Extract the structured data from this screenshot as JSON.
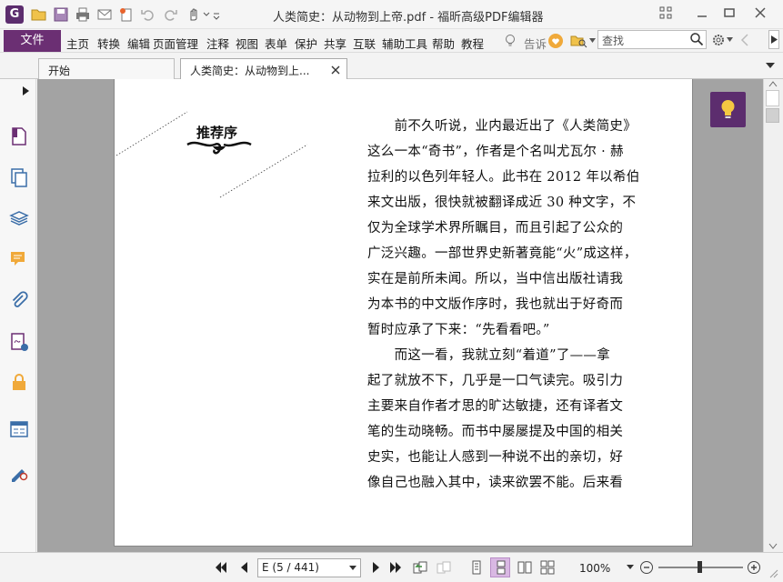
{
  "window": {
    "title": "人类简史：从动物到上帝.pdf - 福昕高级PDF编辑器",
    "logo_letter": "G"
  },
  "menu": {
    "file": "文件",
    "items": [
      "主页",
      "转换",
      "编辑",
      "页面管理",
      "注释",
      "视图",
      "表单",
      "保护",
      "共享",
      "互联",
      "辅助工具",
      "帮助",
      "教程"
    ],
    "tell": "告诉",
    "search_placeholder": "查找"
  },
  "tabs": {
    "start": "开始",
    "document": "人类简史：从动物到上..."
  },
  "page": {
    "preface_title": "推荐序",
    "lines": [
      "　　前不久听说，业内最近出了《人类简史》",
      "这么一本“奇书”，作者是个名叫尤瓦尔 · 赫",
      "拉利的以色列年轻人。此书在 2012 年以希伯",
      "来文出版，很快就被翻译成近 30 种文字，不",
      "仅为全球学术界所瞩目，而且引起了公众的",
      "广泛兴趣。一部世界史新著竟能“火”成这样，",
      "实在是前所未闻。所以，当中信出版社请我",
      "为本书的中文版作序时，我也就出于好奇而",
      "暂时应承了下来：“先看看吧。”",
      "　　而这一看，我就立刻“着道”了——拿",
      "起了就放不下，几乎是一口气读完。吸引力",
      "主要来自作者才思的旷达敏捷，还有译者文",
      "笔的生动晓畅。而书中屡屡提及中国的相关",
      "史实，也能让人感到一种说不出的亲切，好",
      "像自己也融入其中，读来欲罢不能。后来看"
    ]
  },
  "status": {
    "page_indicator": "E (5 / 441)",
    "zoom": "100%"
  },
  "colors": {
    "accent": "#6b2f73",
    "hint": "#5c2d6e",
    "canvas": "#a3a3a3"
  }
}
